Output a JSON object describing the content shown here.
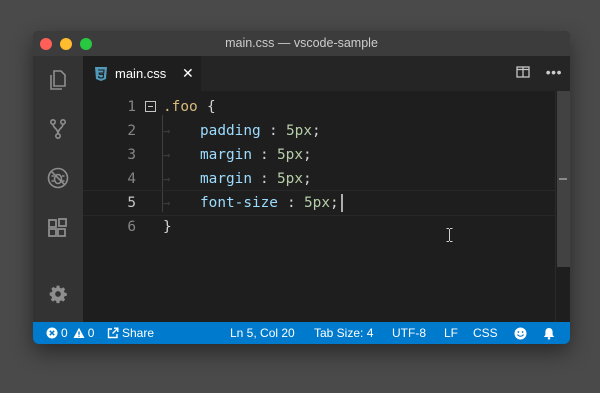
{
  "window": {
    "title": "main.css — vscode-sample"
  },
  "activity_bar": {
    "items": [
      "explorer-icon",
      "source-control-icon",
      "debug-icon",
      "extensions-icon"
    ],
    "settings_icon": "gear-icon"
  },
  "tabs": [
    {
      "label": "main.css",
      "icon": "css-file-icon",
      "close": "✕"
    }
  ],
  "editor": {
    "line_numbers": [
      "1",
      "2",
      "3",
      "4",
      "5",
      "6"
    ],
    "current_line": 5,
    "cursor": {
      "line": 5,
      "col": 20
    },
    "lines": [
      {
        "selector": ".foo",
        "brace": "{"
      },
      {
        "property": "padding",
        "colon": ":",
        "value": "5px",
        "semi": ";"
      },
      {
        "property": "margin",
        "colon": ":",
        "value": "5px",
        "semi": ";"
      },
      {
        "property": "margin",
        "colon": ":",
        "value": "5px",
        "semi": ";"
      },
      {
        "property": "font-size",
        "colon": ":",
        "value": "5px",
        "semi": ";"
      },
      {
        "brace": "}"
      }
    ],
    "whitespace_glyph": "→"
  },
  "status_bar": {
    "errors": "0",
    "warnings": "0",
    "share": "Share",
    "position": "Ln 5, Col 20",
    "tab_size": "Tab Size: 4",
    "encoding": "UTF-8",
    "eol": "LF",
    "language": "CSS"
  },
  "colors": {
    "status_bar": "#007acc",
    "selector": "#d7ba7d",
    "property": "#9cdcfe",
    "number": "#b5cea8"
  }
}
